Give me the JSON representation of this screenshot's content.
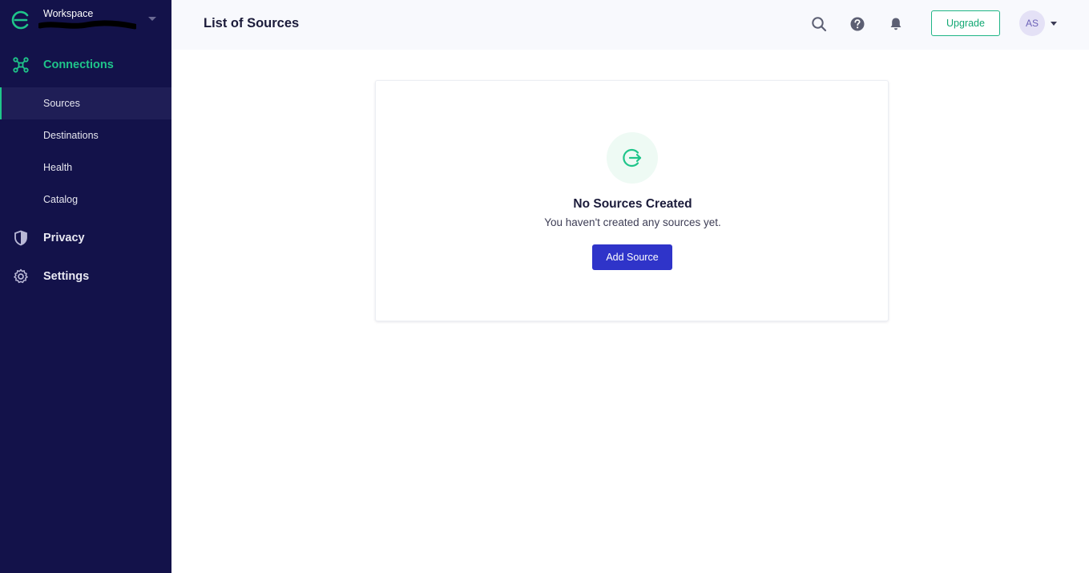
{
  "workspace": {
    "label": "Workspace",
    "name": ""
  },
  "sidebar": {
    "connections_label": "Connections",
    "items": [
      {
        "label": "Sources",
        "active": true
      },
      {
        "label": "Destinations",
        "active": false
      },
      {
        "label": "Health",
        "active": false
      },
      {
        "label": "Catalog",
        "active": false
      }
    ],
    "privacy_label": "Privacy",
    "settings_label": "Settings"
  },
  "header": {
    "title": "List of Sources",
    "upgrade_label": "Upgrade",
    "avatar_initials": "AS"
  },
  "empty_state": {
    "title": "No Sources Created",
    "description": "You haven't created any sources yet.",
    "button_label": "Add Source"
  },
  "colors": {
    "sidebar_bg": "#13124a",
    "accent_green": "#1fc58a",
    "primary_button": "#2f34c9"
  },
  "icons": [
    "workspace-logo-icon",
    "connections-icon",
    "privacy-shield-icon",
    "settings-gear-icon",
    "search-icon",
    "help-icon",
    "bell-icon",
    "source-exit-icon"
  ]
}
